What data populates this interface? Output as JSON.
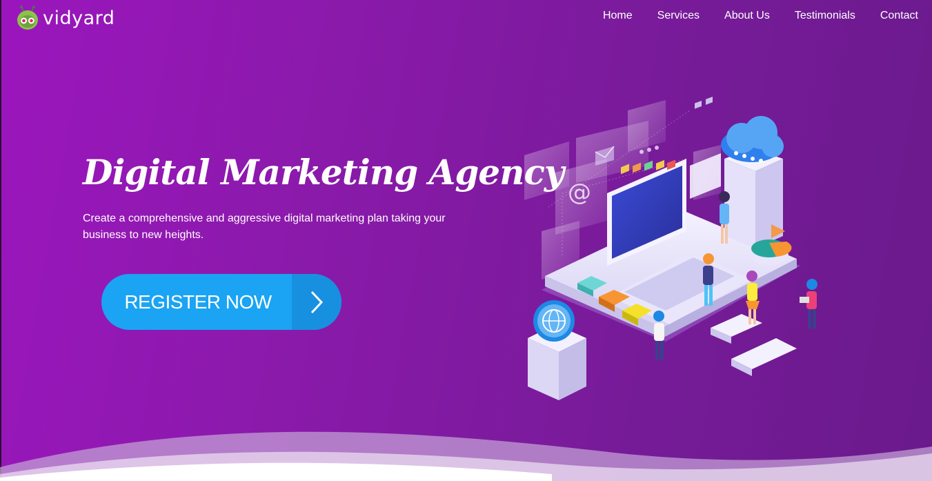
{
  "brand": {
    "name": "vidyard",
    "icon": "robot-face-logo-icon"
  },
  "nav": {
    "items": [
      {
        "label": "Home"
      },
      {
        "label": "Services"
      },
      {
        "label": "About Us"
      },
      {
        "label": "Testimonials"
      },
      {
        "label": "Contact"
      }
    ]
  },
  "hero": {
    "title": "Digital Marketing Agency",
    "subtitle": "Create a comprehensive and aggressive digital marketing plan taking your business to new heights.",
    "cta_label": "REGISTER NOW",
    "cta_icon": "chevron-right-icon"
  },
  "colors": {
    "background_start": "#9b16bd",
    "background_end": "#6a1a8c",
    "cta": "#1aa4f3",
    "cta_arrow": "#1890e0"
  }
}
